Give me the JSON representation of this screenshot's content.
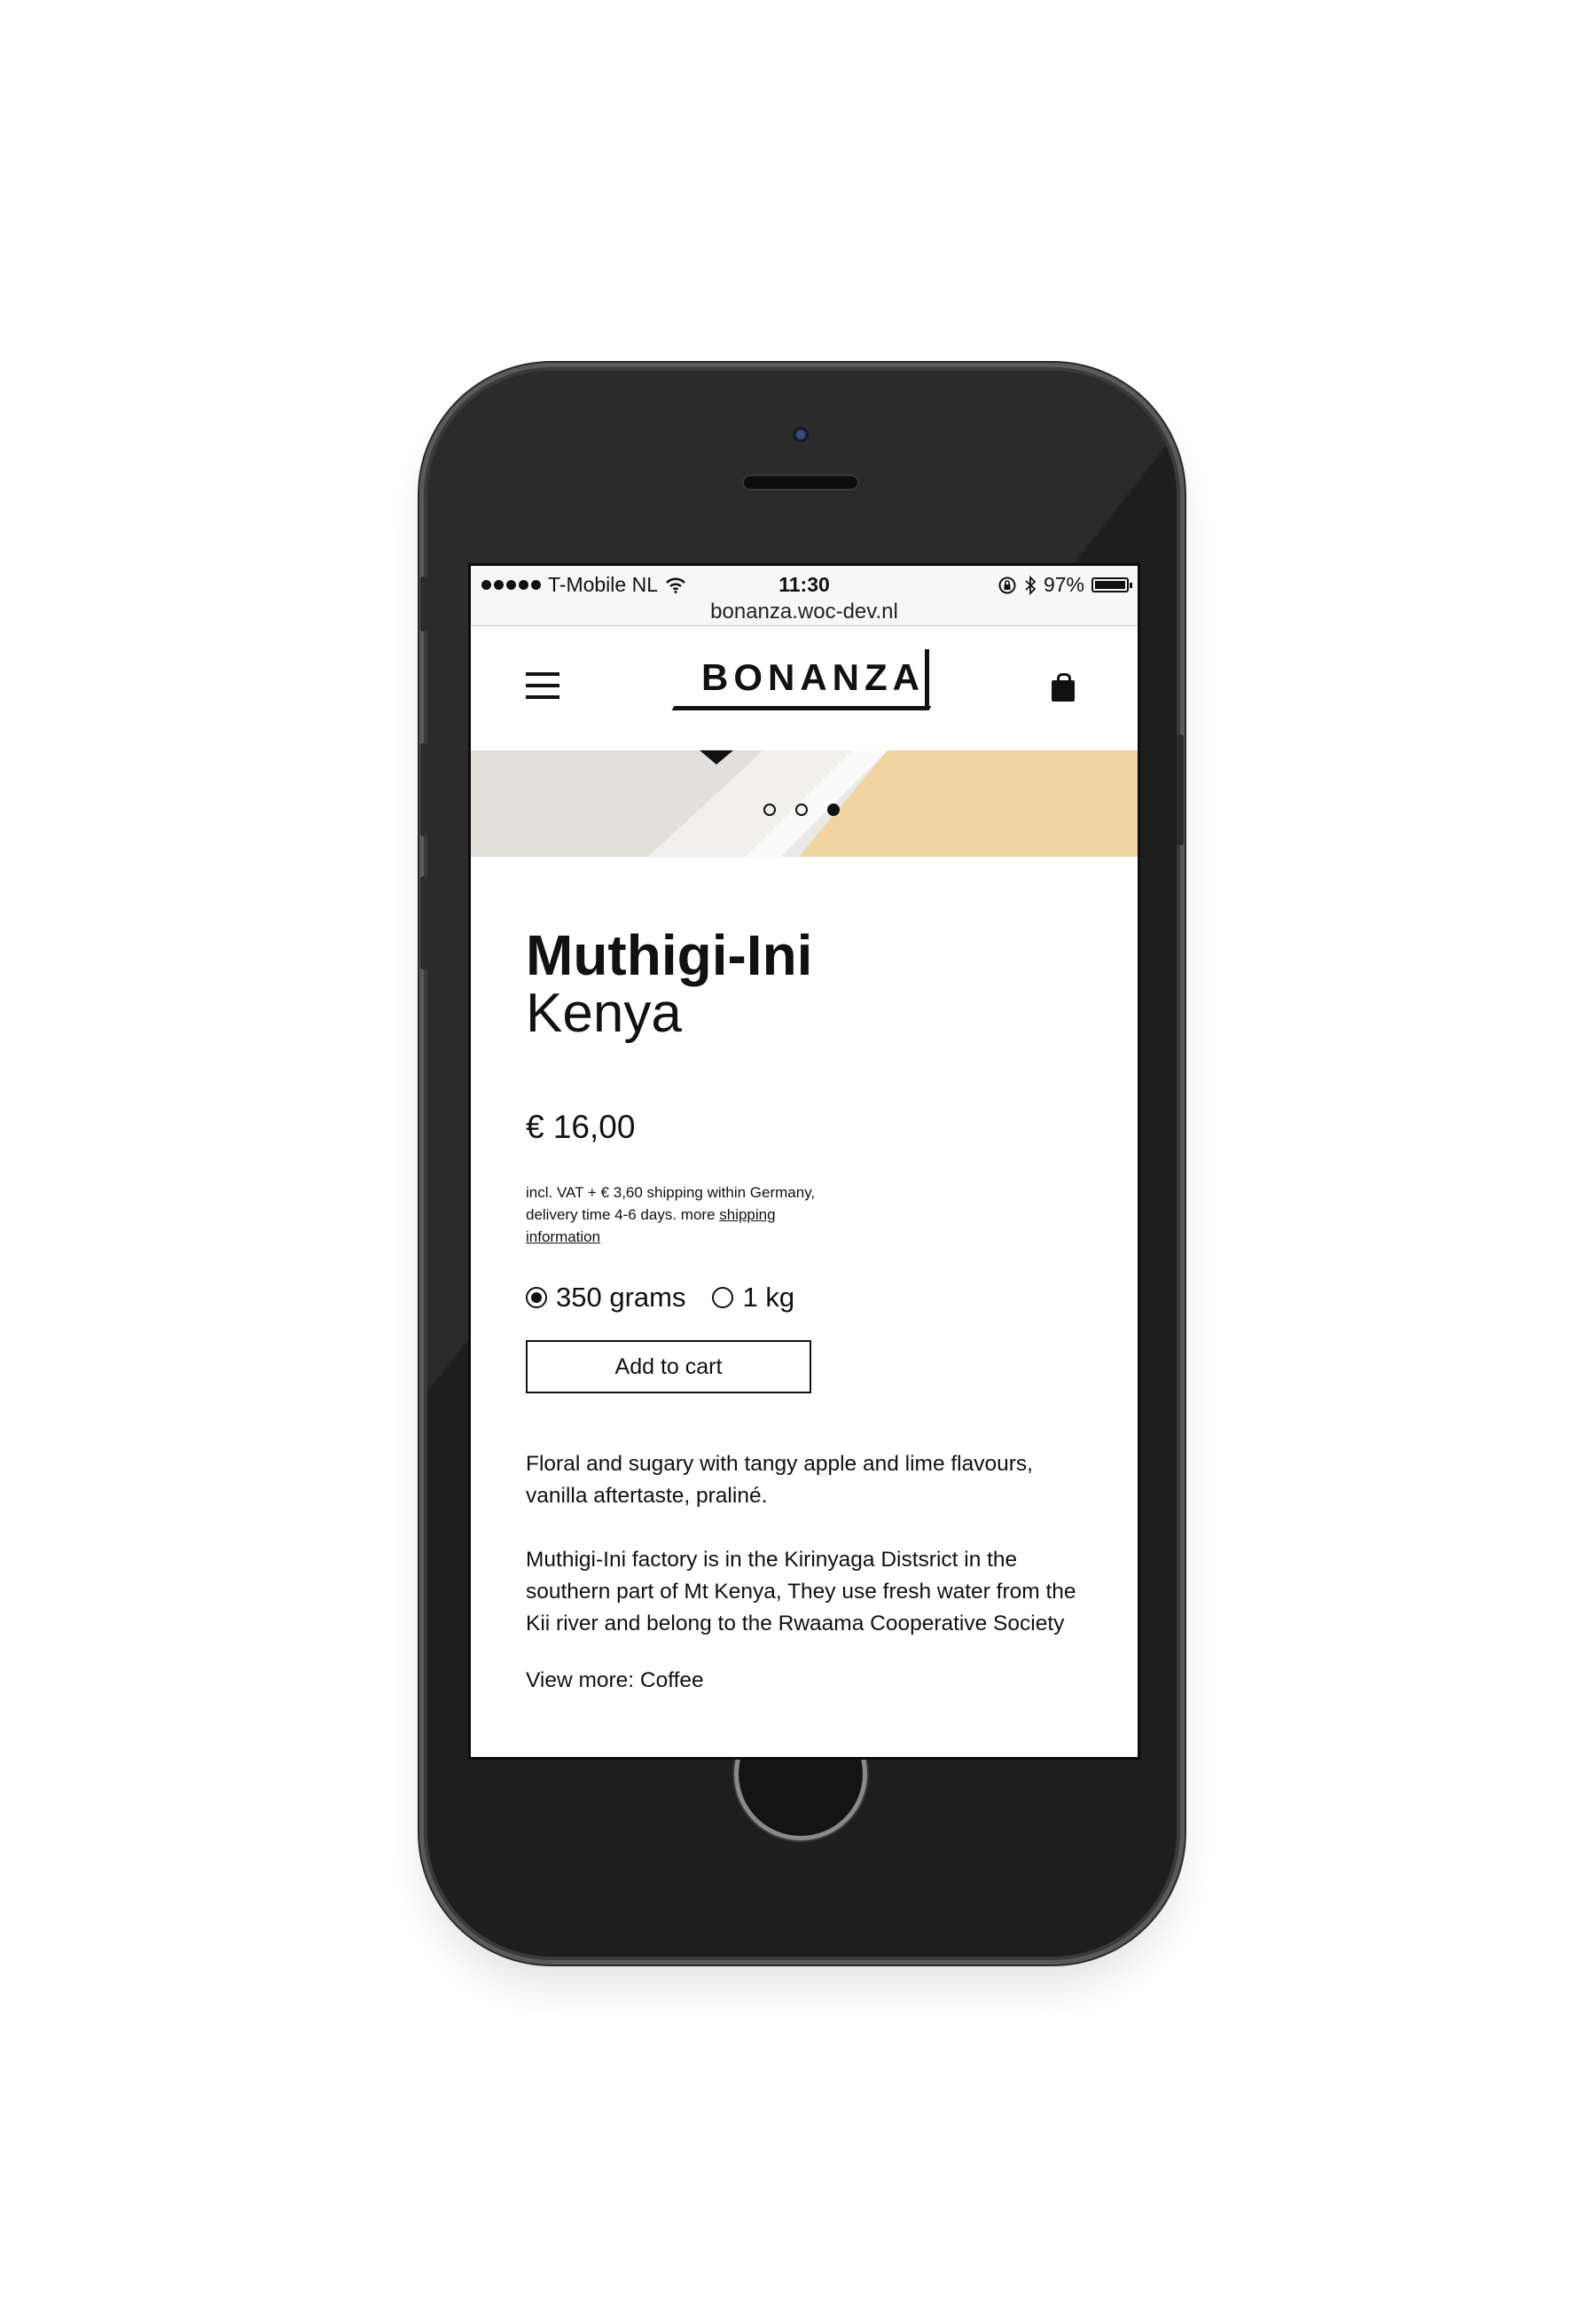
{
  "status_bar": {
    "carrier": "T-Mobile NL",
    "time": "11:30",
    "battery": "97%",
    "battery_level": 0.97,
    "icons": [
      "signal-dots-icon",
      "wifi-icon",
      "rotation-lock-icon",
      "bluetooth-icon",
      "battery-icon"
    ]
  },
  "browser": {
    "url": "bonanza.woc-dev.nl"
  },
  "header": {
    "logo": "BONANZA",
    "menu_icon": "hamburger-menu-icon",
    "cart_icon": "shopping-bag-icon"
  },
  "hero": {
    "slides": 3,
    "active_slide": 3,
    "colors": {
      "paper": "#ebe9e6",
      "accent": "#f0d5a3"
    }
  },
  "product": {
    "name": "Muthigi-Ini",
    "origin": "Kenya",
    "price": "€ 16,00",
    "shipping_text": "incl. VAT + € 3,60 shipping within Germany, delivery time 4-6 days. more ",
    "shipping_link": "shipping",
    "shipping_link_2": "information",
    "options": [
      {
        "label": "350 grams",
        "selected": true
      },
      {
        "label": "1 kg",
        "selected": false
      }
    ],
    "add_to_cart": "Add to cart",
    "description": [
      "Floral and sugary with tangy apple and lime flavours, vanilla aftertaste, praliné.",
      "Muthigi-Ini factory is in the Kirinyaga Distsrict in the southern part of Mt Kenya, They use fresh water from the Kii river and belong to the Rwaama Cooperative Society"
    ],
    "view_more": "View more: Coffee"
  }
}
